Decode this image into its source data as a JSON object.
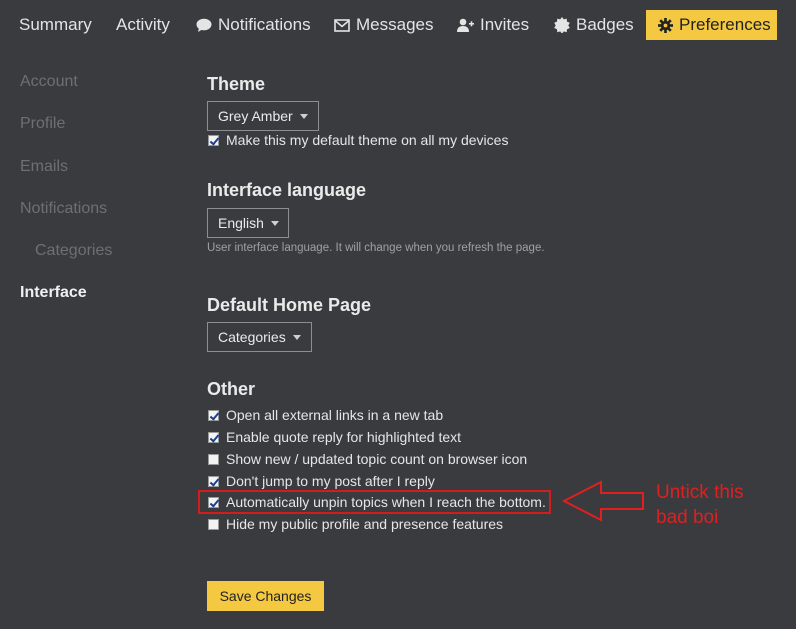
{
  "nav": {
    "summary": "Summary",
    "activity": "Activity",
    "notifications": "Notifications",
    "messages": "Messages",
    "invites": "Invites",
    "badges": "Badges",
    "preferences": "Preferences"
  },
  "sidebar": {
    "items": [
      {
        "label": "Account"
      },
      {
        "label": "Profile"
      },
      {
        "label": "Emails"
      },
      {
        "label": "Notifications"
      },
      {
        "label": "Categories"
      },
      {
        "label": "Interface"
      }
    ]
  },
  "theme": {
    "title": "Theme",
    "selected": "Grey Amber",
    "default_label": "Make this my default theme on all my devices",
    "default_checked": true
  },
  "language": {
    "title": "Interface language",
    "selected": "English",
    "help": "User interface language. It will change when you refresh the page."
  },
  "home_page": {
    "title": "Default Home Page",
    "selected": "Categories"
  },
  "other": {
    "title": "Other",
    "options": [
      {
        "label": "Open all external links in a new tab",
        "checked": true
      },
      {
        "label": "Enable quote reply for highlighted text",
        "checked": true
      },
      {
        "label": "Show new / updated topic count on browser icon",
        "checked": false
      },
      {
        "label": "Don't jump to my post after I reply",
        "checked": true
      },
      {
        "label": "Automatically unpin topics when I reach the bottom.",
        "checked": true
      },
      {
        "label": "Hide my public profile and presence features",
        "checked": false
      }
    ]
  },
  "save_label": "Save Changes",
  "annotation": {
    "text": "Untick this bad boi",
    "color": "#e01f1f"
  },
  "colors": {
    "background": "#3a3b3f",
    "accent": "#f5c842"
  }
}
